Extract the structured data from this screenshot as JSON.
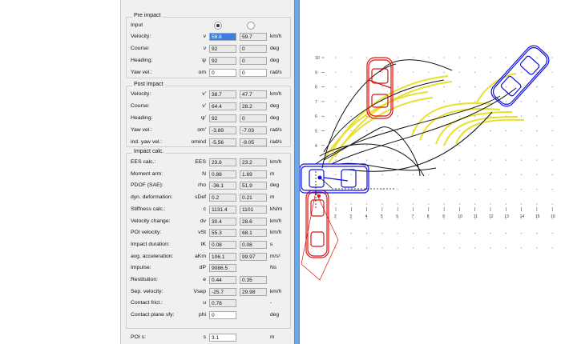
{
  "pre_impact": {
    "title": "Pre impact",
    "input_label": "Input",
    "rows": [
      {
        "label": "Velocity:",
        "sym": "v",
        "v1": "58.6",
        "v2": "59.7",
        "unit": "km/h",
        "v1_selected": true
      },
      {
        "label": "Course:",
        "sym": "ν",
        "v1": "92",
        "v2": "0",
        "unit": "deg"
      },
      {
        "label": "Heading:",
        "sym": "ψ",
        "v1": "92",
        "v2": "0",
        "unit": "deg"
      },
      {
        "label": "Yaw vel.:",
        "sym": "om",
        "v1": "0",
        "v2": "0",
        "unit": "rad/s",
        "editable": true
      }
    ]
  },
  "post_impact": {
    "title": "Post impact",
    "rows": [
      {
        "label": "Velocity:",
        "sym": "v'",
        "v1": "38.7",
        "v2": "47.7",
        "unit": "km/h"
      },
      {
        "label": "Course:",
        "sym": "ν'",
        "v1": "64.4",
        "v2": "28.2",
        "unit": "deg"
      },
      {
        "label": "Heading:",
        "sym": "ψ'",
        "v1": "92",
        "v2": "0",
        "unit": "deg"
      },
      {
        "label": "Yaw vel.:",
        "sym": "om'",
        "v1": "-3.89",
        "v2": "-7.03",
        "unit": "rad/s"
      },
      {
        "label": "ind. yaw vel.:",
        "sym": "omind",
        "v1": "-5.56",
        "v2": "-9.05",
        "unit": "rad/s"
      }
    ]
  },
  "impact_calc": {
    "title": "Impact calc.",
    "rows": [
      {
        "label": "EES calc.:",
        "sym": "EES",
        "v1": "23.6",
        "v2": "23.2",
        "unit": "km/h"
      },
      {
        "label": "Moment arm:",
        "sym": "N",
        "v1": "0.88",
        "v2": "1.69",
        "unit": "m"
      },
      {
        "label": "PDOF (SAE):",
        "sym": "rho",
        "v1": "-36.1",
        "v2": "51.9",
        "unit": "deg"
      },
      {
        "label": "dyn. deformation:",
        "sym": "sDef",
        "v1": "0.2",
        "v2": "0.21",
        "unit": "m"
      },
      {
        "label": "Stiffness calc.:",
        "sym": "c",
        "v1": "1131.4",
        "v2": "1101",
        "unit": "kN/m"
      },
      {
        "label": "Velocity change:",
        "sym": "dv",
        "v1": "30.4",
        "v2": "28.6",
        "unit": "km/h"
      },
      {
        "label": "POI velocity:",
        "sym": "vSt",
        "v1": "55.3",
        "v2": "68.1",
        "unit": "km/h"
      },
      {
        "label": "Impact duration:",
        "sym": "tK",
        "v1": "0.08",
        "v2": "0.08",
        "unit": "s"
      },
      {
        "label": "avg. acceleration:",
        "sym": "aKm",
        "v1": "106.1",
        "v2": "99.97",
        "unit": "m/s²"
      },
      {
        "label": "Impulse:",
        "sym": "dP",
        "v1": "9086.5",
        "v2": "",
        "unit": "Ns"
      },
      {
        "label": "Restitution:",
        "sym": "e",
        "v1": "0.44",
        "v2": "0.35",
        "unit": ""
      },
      {
        "label": "Sep. velocity:",
        "sym": "Vsep",
        "v1": "-25.7",
        "v2": "29.98",
        "unit": "km/h"
      },
      {
        "label": "Contact frict.:",
        "sym": "u",
        "v1": "0.78",
        "v2": "",
        "unit": "-"
      },
      {
        "label": "Contact plane sfy:",
        "sym": "phi",
        "v1": "0",
        "v2": "",
        "unit": "deg",
        "editable": true
      }
    ]
  },
  "poi": {
    "label": "POI s:",
    "sym": "s",
    "value": "3.1",
    "unit": "m"
  },
  "canvas": {
    "y_ticks": [
      "10",
      "9",
      "8",
      "7",
      "6",
      "5",
      "4"
    ],
    "x_ticks": [
      "2",
      "3",
      "4",
      "5",
      "6",
      "7",
      "8",
      "9",
      "10",
      "11",
      "12",
      "13",
      "14",
      "15",
      "16"
    ],
    "colors": {
      "vehicle1": "#e01010",
      "vehicle2": "#1010e0",
      "trajectory": "#111111",
      "tire_marks": "#e8e02a"
    }
  }
}
